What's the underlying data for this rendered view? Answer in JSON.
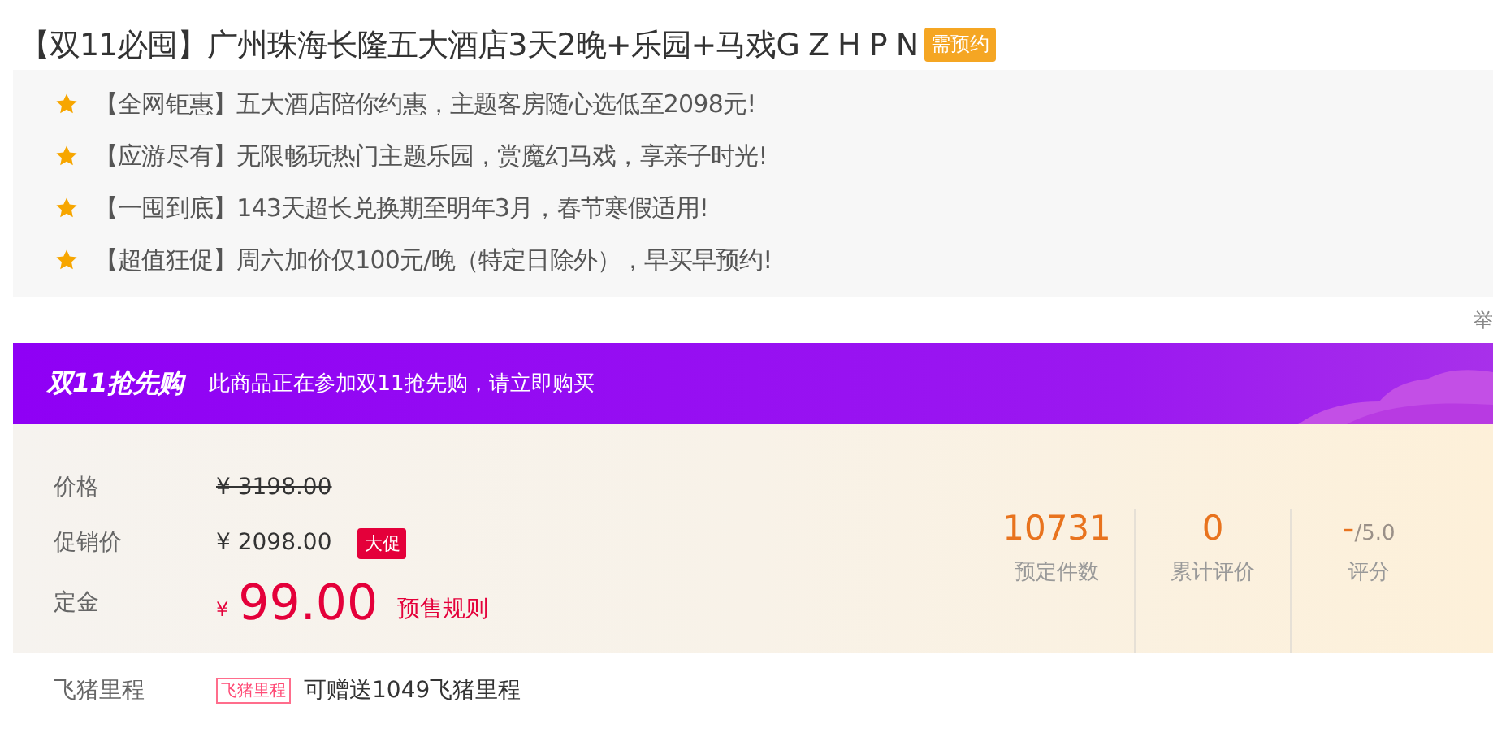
{
  "title": {
    "text": "【双11必囤】广州珠海长隆五大酒店3天2晚+乐园+马戏G Z H P N",
    "badge": "需预约"
  },
  "highlights": [
    {
      "text": "【全网钜惠】五大酒店陪你约惠，主题客房随心选低至2098元!"
    },
    {
      "text": "【应游尽有】无限畅玩热门主题乐园，赏魔幻马戏，享亲子时光!"
    },
    {
      "text": "【一囤到底】143天超长兑换期至明年3月，春节寒假适用!"
    },
    {
      "text": "【超值狂促】周六加价仅100元/晚（特定日除外），早买早预约!"
    }
  ],
  "report_link": "举",
  "banner": {
    "logo": "双11抢先购",
    "text": "此商品正在参加双11抢先购，请立即购买"
  },
  "prices": {
    "original_label": "价格",
    "original": "¥ 3198.00",
    "promo_label": "促销价",
    "promo": "¥ 2098.00",
    "promo_tag": "大促",
    "deposit_label": "定金",
    "deposit_currency": "¥",
    "deposit": "99.00",
    "rules_link": "预售规则"
  },
  "stats": [
    {
      "value": "10731",
      "label": "预定件数",
      "kind": "count"
    },
    {
      "value": "0",
      "label": "累计评价",
      "kind": "count"
    },
    {
      "value": "-",
      "suffix": "/5.0",
      "label": "评分",
      "kind": "score"
    }
  ],
  "mileage": {
    "label": "飞猪里程",
    "tag": "飞猪里程",
    "text": "可赠送1049飞猪里程"
  }
}
